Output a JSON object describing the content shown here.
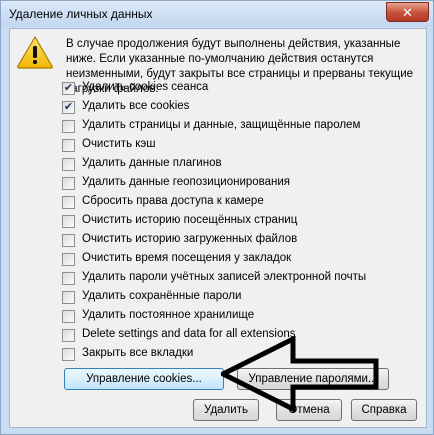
{
  "window": {
    "title": "Удаление личных данных",
    "close_icon": "close-icon"
  },
  "warning": {
    "icon": "warning-icon",
    "text": "В случае продолжения будут выполнены действия, указанные ниже. Если указанные по-умолчанию действия останутся неизменными, будут закрыты все страницы и прерваны текущие загрузки файлов."
  },
  "options": [
    {
      "label": "Удалить cookies сеанса",
      "checked": true
    },
    {
      "label": "Удалить все cookies",
      "checked": true
    },
    {
      "label": "Удалить страницы и данные, защищённые паролем",
      "checked": false
    },
    {
      "label": "Очистить кэш",
      "checked": false
    },
    {
      "label": "Удалить данные плагинов",
      "checked": false
    },
    {
      "label": "Удалить данные геопозиционирования",
      "checked": false
    },
    {
      "label": "Сбросить права доступа к камере",
      "checked": false
    },
    {
      "label": "Очистить историю посещённых страниц",
      "checked": false
    },
    {
      "label": "Очистить историю загруженных файлов",
      "checked": false
    },
    {
      "label": "Очистить время посещения у закладок",
      "checked": false
    },
    {
      "label": "Удалить пароли учётных записей электронной почты",
      "checked": false
    },
    {
      "label": "Удалить сохранённые пароли",
      "checked": false
    },
    {
      "label": "Удалить постоянное хранилище",
      "checked": false
    },
    {
      "label": "Delete settings and data for all extensions",
      "checked": false
    },
    {
      "label": "Закрыть все вкладки",
      "checked": false
    }
  ],
  "buttons": {
    "manage_cookies": "Управление cookies...",
    "manage_passwords": "Управление паролями...",
    "delete": "Удалить",
    "cancel": "Отмена",
    "help": "Справка"
  },
  "annotation": {
    "icon": "arrow-left-icon"
  }
}
